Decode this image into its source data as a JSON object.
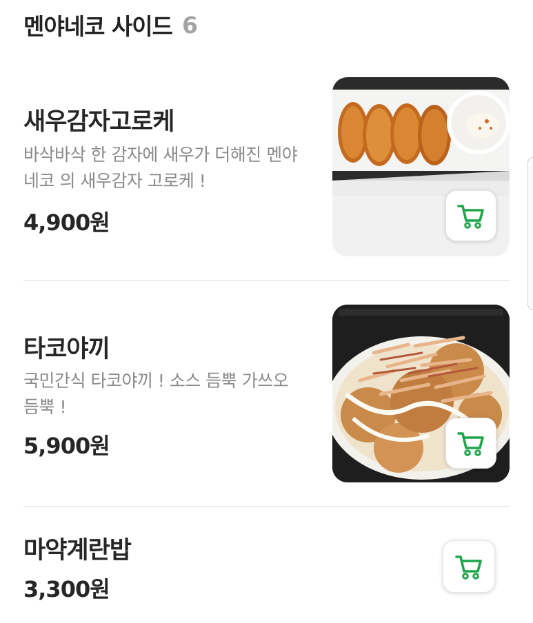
{
  "section": {
    "title": "멘야네코 사이드",
    "count": "6"
  },
  "items": [
    {
      "name": "새우감자고로케",
      "description": "바삭바삭 한 감자에 새우가 더해진 멘야네코 의 새우감자 고로케 !",
      "price": "4,900원",
      "image": "croquette-photo"
    },
    {
      "name": "타코야끼",
      "description": "국민간식 타코야끼 ! 소스 듬뿍 가쓰오 듬뿍 !",
      "price": "5,900원",
      "image": "takoyaki-photo"
    },
    {
      "name": "마약계란밥",
      "description": "",
      "price": "3,300원",
      "image": ""
    }
  ],
  "icons": {
    "cart": "shopping-cart-icon"
  },
  "colors": {
    "cart_green": "#1fa64a",
    "divider": "#ececec",
    "muted_text": "#8a8a8a"
  }
}
